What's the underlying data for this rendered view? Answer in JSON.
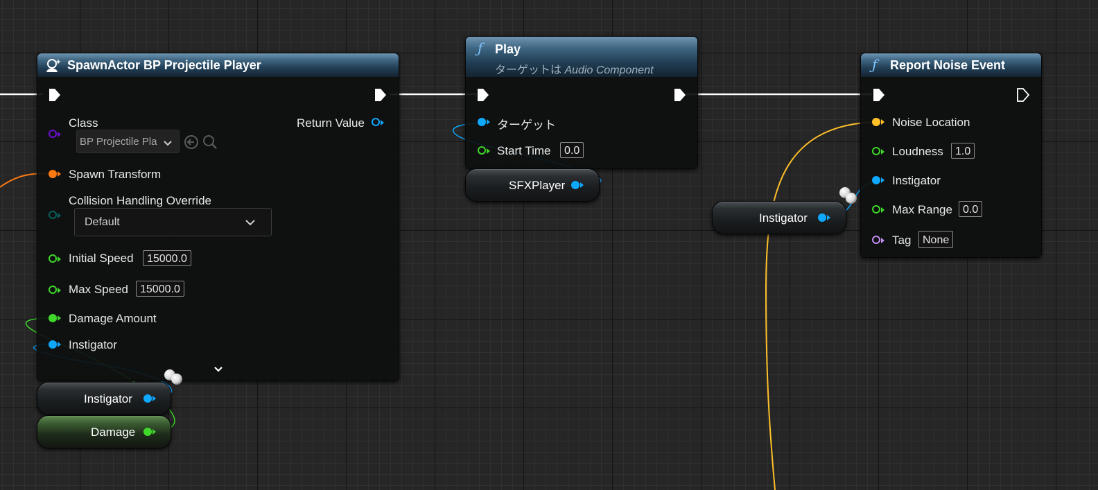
{
  "nodes": {
    "spawn": {
      "title": "SpawnActor BP Projectile Player",
      "class_label": "Class",
      "class_value": "BP Projectile Pla",
      "return_value_label": "Return Value",
      "spawn_transform_label": "Spawn Transform",
      "collision_label": "Collision Handling Override",
      "collision_value": "Default",
      "initial_speed_label": "Initial Speed",
      "initial_speed_value": "15000.0",
      "max_speed_label": "Max Speed",
      "max_speed_value": "15000.0",
      "damage_amount_label": "Damage Amount",
      "instigator_label": "Instigator"
    },
    "play": {
      "title": "Play",
      "subtitle_prefix": "ターゲットは ",
      "subtitle_target": "Audio Component",
      "target_label": "ターゲット",
      "start_time_label": "Start Time",
      "start_time_value": "0.0"
    },
    "report": {
      "title": "Report Noise Event",
      "noise_location_label": "Noise Location",
      "loudness_label": "Loudness",
      "loudness_value": "1.0",
      "instigator_label": "Instigator",
      "max_range_label": "Max Range",
      "max_range_value": "0.0",
      "tag_label": "Tag",
      "tag_value": "None"
    }
  },
  "variables": {
    "sfx_player": "SFXPlayer",
    "instigator_right": "Instigator",
    "instigator_left": "Instigator",
    "damage": "Damage"
  },
  "colors": {
    "exec_wire": "#ffffff",
    "object_pin": "#0fa8ff",
    "float_pin": "#3fd82a",
    "struct_pin": "#ff7a12",
    "vector_pin": "#ffc02a",
    "class_pin": "#6a0fcf",
    "enum_pin": "#0b5c5a",
    "name_pin": "#c48df0"
  },
  "icons": [
    "function-icon",
    "spawn-actor-icon",
    "exec-pin-icon",
    "browse-back-icon",
    "search-icon",
    "chevron-down-icon",
    "reroute-knot-icon"
  ]
}
